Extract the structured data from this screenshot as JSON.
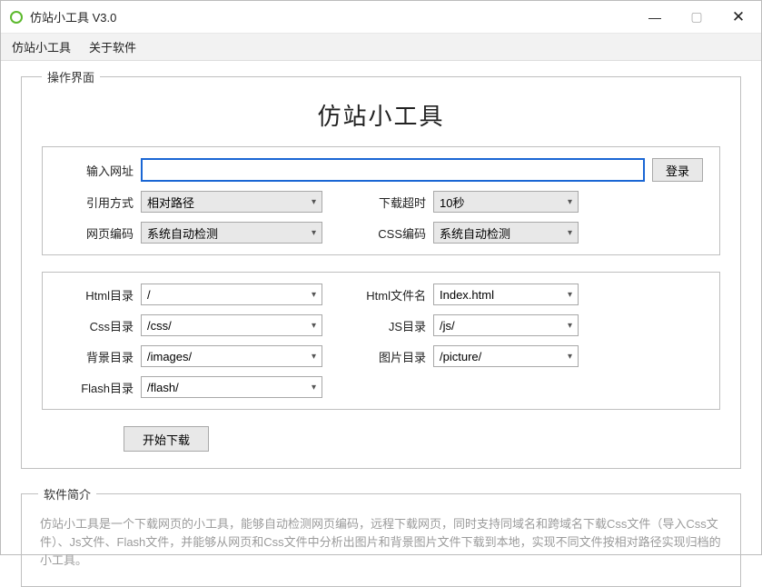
{
  "window": {
    "title": "仿站小工具 V3.0"
  },
  "menu": {
    "items": [
      "仿站小工具",
      "关于软件"
    ]
  },
  "panel": {
    "legend": "操作界面",
    "heading": "仿站小工具",
    "url_label": "输入网址",
    "url_value": "",
    "login_btn": "登录",
    "ref_label": "引用方式",
    "ref_value": "相对路径",
    "timeout_label": "下载超时",
    "timeout_value": "10秒",
    "page_enc_label": "网页编码",
    "page_enc_value": "系统自动检测",
    "css_enc_label": "CSS编码",
    "css_enc_value": "系统自动检测",
    "html_dir_label": "Html目录",
    "html_dir_value": "/",
    "html_file_label": "Html文件名",
    "html_file_value": "Index.html",
    "css_dir_label": "Css目录",
    "css_dir_value": "/css/",
    "js_dir_label": "JS目录",
    "js_dir_value": "/js/",
    "bg_dir_label": "背景目录",
    "bg_dir_value": "/images/",
    "pic_dir_label": "图片目录",
    "pic_dir_value": "/picture/",
    "flash_dir_label": "Flash目录",
    "flash_dir_value": "/flash/",
    "start_btn": "开始下载"
  },
  "intro": {
    "legend": "软件简介",
    "text": "仿站小工具是一个下载网页的小工具，能够自动检测网页编码，远程下载网页，同时支持同域名和跨域名下载Css文件（导入Css文件）、Js文件、Flash文件，并能够从网页和Css文件中分析出图片和背景图片文件下载到本地，实现不同文件按相对路径实现归档的小工具。"
  }
}
